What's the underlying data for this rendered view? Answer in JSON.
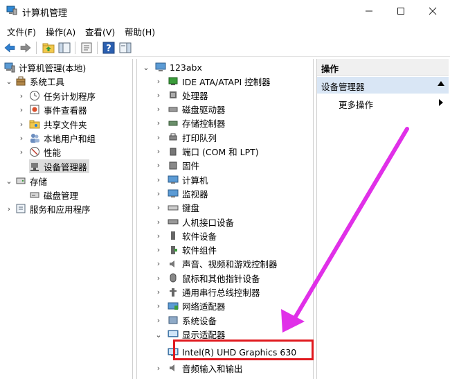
{
  "window": {
    "title": "计算机管理",
    "controls": [
      "minimize",
      "maximize",
      "close"
    ]
  },
  "menu": {
    "items": [
      "文件(F)",
      "操作(A)",
      "查看(V)",
      "帮助(H)"
    ]
  },
  "toolbar": {
    "icons": [
      "back-icon",
      "forward-icon",
      "up-folder-icon",
      "show-tree-icon",
      "properties-icon",
      "help-icon",
      "show-action-pane-icon"
    ]
  },
  "left_tree": {
    "root": "计算机管理(本地)",
    "system_tools": "系统工具",
    "task_scheduler": "任务计划程序",
    "event_viewer": "事件查看器",
    "shared_folders": "共享文件夹",
    "local_users": "本地用户和组",
    "performance": "性能",
    "device_manager": "设备管理器",
    "storage": "存储",
    "disk_management": "磁盘管理",
    "services": "服务和应用程序"
  },
  "device_tree": {
    "computer": "123abx",
    "categories": [
      "IDE ATA/ATAPI 控制器",
      "处理器",
      "磁盘驱动器",
      "存储控制器",
      "打印队列",
      "端口 (COM 和 LPT)",
      "固件",
      "计算机",
      "监视器",
      "键盘",
      "人机接口设备",
      "软件设备",
      "软件组件",
      "声音、视频和游戏控制器",
      "鼠标和其他指针设备",
      "通用串行总线控制器",
      "网络适配器",
      "系统设备",
      "显示适配器"
    ],
    "display_child": "Intel(R) UHD Graphics 630",
    "last_partial": "音频输入和输出"
  },
  "actions": {
    "header": "操作",
    "group": "设备管理器",
    "more": "更多操作"
  },
  "annotation": {
    "highlight_color": "#e0191e",
    "arrow_color": "#e030e8"
  }
}
